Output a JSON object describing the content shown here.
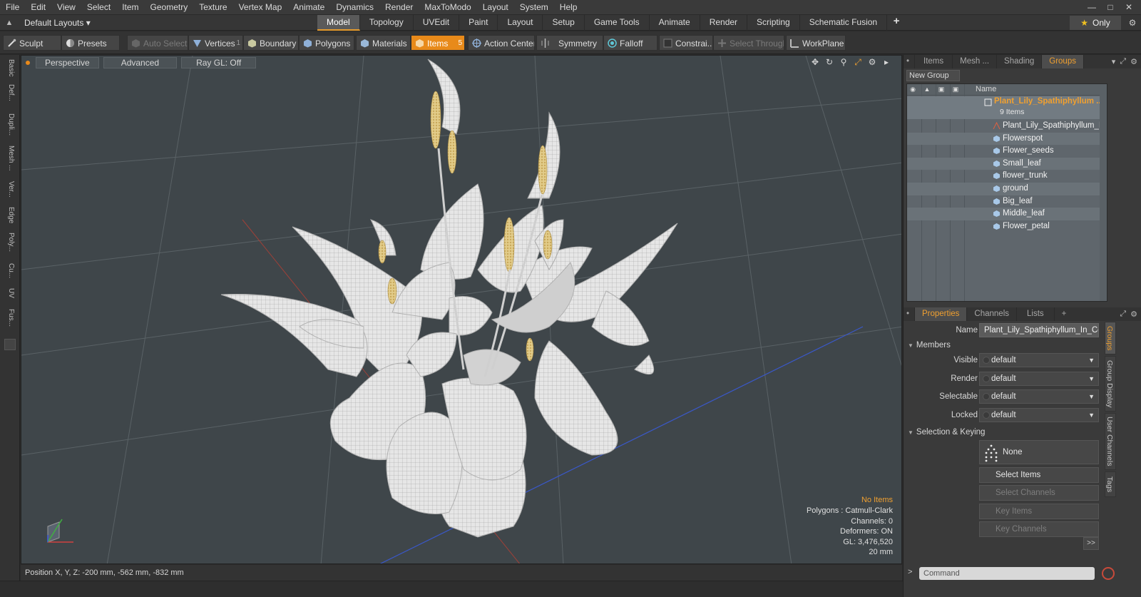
{
  "menu": [
    "File",
    "Edit",
    "View",
    "Select",
    "Item",
    "Geometry",
    "Texture",
    "Vertex Map",
    "Animate",
    "Dynamics",
    "Render",
    "MaxToModo",
    "Layout",
    "System",
    "Help"
  ],
  "layout_bar": {
    "layouts_label": "Default Layouts",
    "tabs": [
      "Model",
      "Topology",
      "UVEdit",
      "Paint",
      "Layout",
      "Setup",
      "Game Tools",
      "Animate",
      "Render",
      "Scripting",
      "Schematic Fusion"
    ],
    "active_tab": "Model",
    "only_label": "Only"
  },
  "toolbar": {
    "sculpt": "Sculpt",
    "presets": "Presets",
    "auto_select": "Auto Select",
    "vertices": "Vertices",
    "vertices_count": "1",
    "boundary": "Boundary",
    "polygons": "Polygons",
    "materials": "Materials",
    "items": "Items",
    "items_count": "5",
    "action_center": "Action Center",
    "symmetry": "Symmetry",
    "falloff": "Falloff",
    "constraints": "Constrai...",
    "select_through": "Select Through",
    "workplane": "WorkPlane"
  },
  "left_tabs": [
    "Basic",
    "Def...",
    "Dupli...",
    "Mesh ...",
    "Ver...",
    "Edge",
    "Poly...",
    "Cu...",
    "UV",
    "Fus..."
  ],
  "viewport": {
    "view_mode": "Perspective",
    "advanced": "Advanced",
    "raygl": "Ray GL: Off",
    "info": {
      "selection": "No Items",
      "polygons": "Polygons : Catmull-Clark",
      "channels": "Channels: 0",
      "deformers": "Deformers: ON",
      "gl": "GL: 3,476,520",
      "scale": "20 mm"
    },
    "colors": {
      "background": "#3f464a",
      "accent": "#f0a030"
    }
  },
  "status": {
    "position": "Position X, Y, Z:  -200 mm, -562 mm, -832 mm"
  },
  "panel_top": {
    "tabs": [
      "Items",
      "Mesh ...",
      "Shading",
      "Groups"
    ],
    "active_tab": "Groups",
    "new_group": "New Group",
    "name_header": "Name",
    "group_name": "Plant_Lily_Spathiphyllum ...",
    "group_count": "9 Items",
    "items": [
      "Plant_Lily_Spathiphyllum_In ...",
      "Flowerspot",
      "Flower_seeds",
      "Small_leaf",
      "flower_trunk",
      "ground",
      "Big_leaf",
      "Middle_leaf",
      "Flower_petal"
    ]
  },
  "panel_bottom": {
    "tabs": [
      "Properties",
      "Channels",
      "Lists"
    ],
    "active_tab": "Properties",
    "name_label": "Name",
    "name_value": "Plant_Lily_Spathiphyllum_In_Cera",
    "members": "Members",
    "visible_label": "Visible",
    "visible_value": "default",
    "render_label": "Render",
    "render_value": "default",
    "selectable_label": "Selectable",
    "selectable_value": "default",
    "locked_label": "Locked",
    "locked_value": "default",
    "selection_keying": "Selection & Keying",
    "none_label": "None",
    "select_items": "Select Items",
    "select_channels": "Select Channels",
    "key_items": "Key Items",
    "key_channels": "Key Channels",
    "more": ">>",
    "side_tabs": [
      "Groups",
      "Group Display",
      "User Channels",
      "Tags"
    ]
  },
  "command": {
    "placeholder": "Command"
  }
}
